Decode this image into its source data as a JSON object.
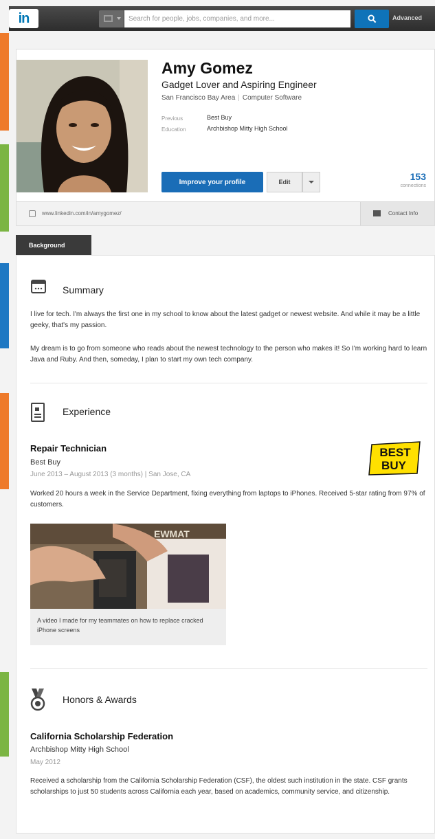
{
  "nav": {
    "logo": "in",
    "search_placeholder": "Search for people, jobs, companies, and more...",
    "advanced": "Advanced"
  },
  "profile": {
    "name": "Amy Gomez",
    "headline": "Gadget Lover and Aspiring Engineer",
    "location": "San Francisco Bay Area",
    "industry": "Computer Software",
    "previous_label": "Previous",
    "previous_value": "Best Buy",
    "education_label": "Education",
    "education_value": "Archbishop Mitty High School",
    "improve_button": "Improve your profile",
    "edit_button": "Edit",
    "connections_count": "153",
    "connections_label": "connections",
    "profile_url": "www.linkedin.com/in/amygomez/",
    "contact_info": "Contact Info"
  },
  "background_tab": "Background",
  "summary": {
    "title": "Summary",
    "p1": "I live for tech. I'm always the first one in my school to know about the latest gadget or newest website. And while it may be a little geeky, that's my passion.",
    "p2": "My dream is to go from someone who reads about the newest technology to the person who makes it! So I'm working hard to learn Java and Ruby. And then, someday, I plan to start my own tech company."
  },
  "experience": {
    "title": "Experience",
    "job_title": "Repair Technician",
    "company": "Best Buy",
    "dates": "June 2013 – August 2013 (3 months) | San Jose, CA",
    "description": "Worked 20 hours a week in the Service Department, fixing everything from laptops to iPhones. Received 5-star rating from 97% of customers.",
    "company_logo_text": [
      "BEST",
      "BUY"
    ],
    "media_overlay_text": "EWMAT",
    "media_caption": "A video I made for my teammates on how to replace cracked iPhone screens"
  },
  "honors": {
    "title": "Honors & Awards",
    "award_title": "California Scholarship Federation",
    "issuer": "Archbishop Mitty High School",
    "date": "May 2012",
    "description": "Received a scholarship from the California Scholarship Federation (CSF), the oldest such institution in the state. CSF grants scholarships to just 50 students across California each year, based on academics, community service, and citizenship."
  },
  "colors": {
    "linkedin_blue": "#0077b5",
    "button_blue": "#1a6db7",
    "strip_orange": "#ee7a2a",
    "strip_green": "#7bb543",
    "strip_blue": "#1e78c3",
    "bestbuy_yellow": "#ffe000"
  }
}
